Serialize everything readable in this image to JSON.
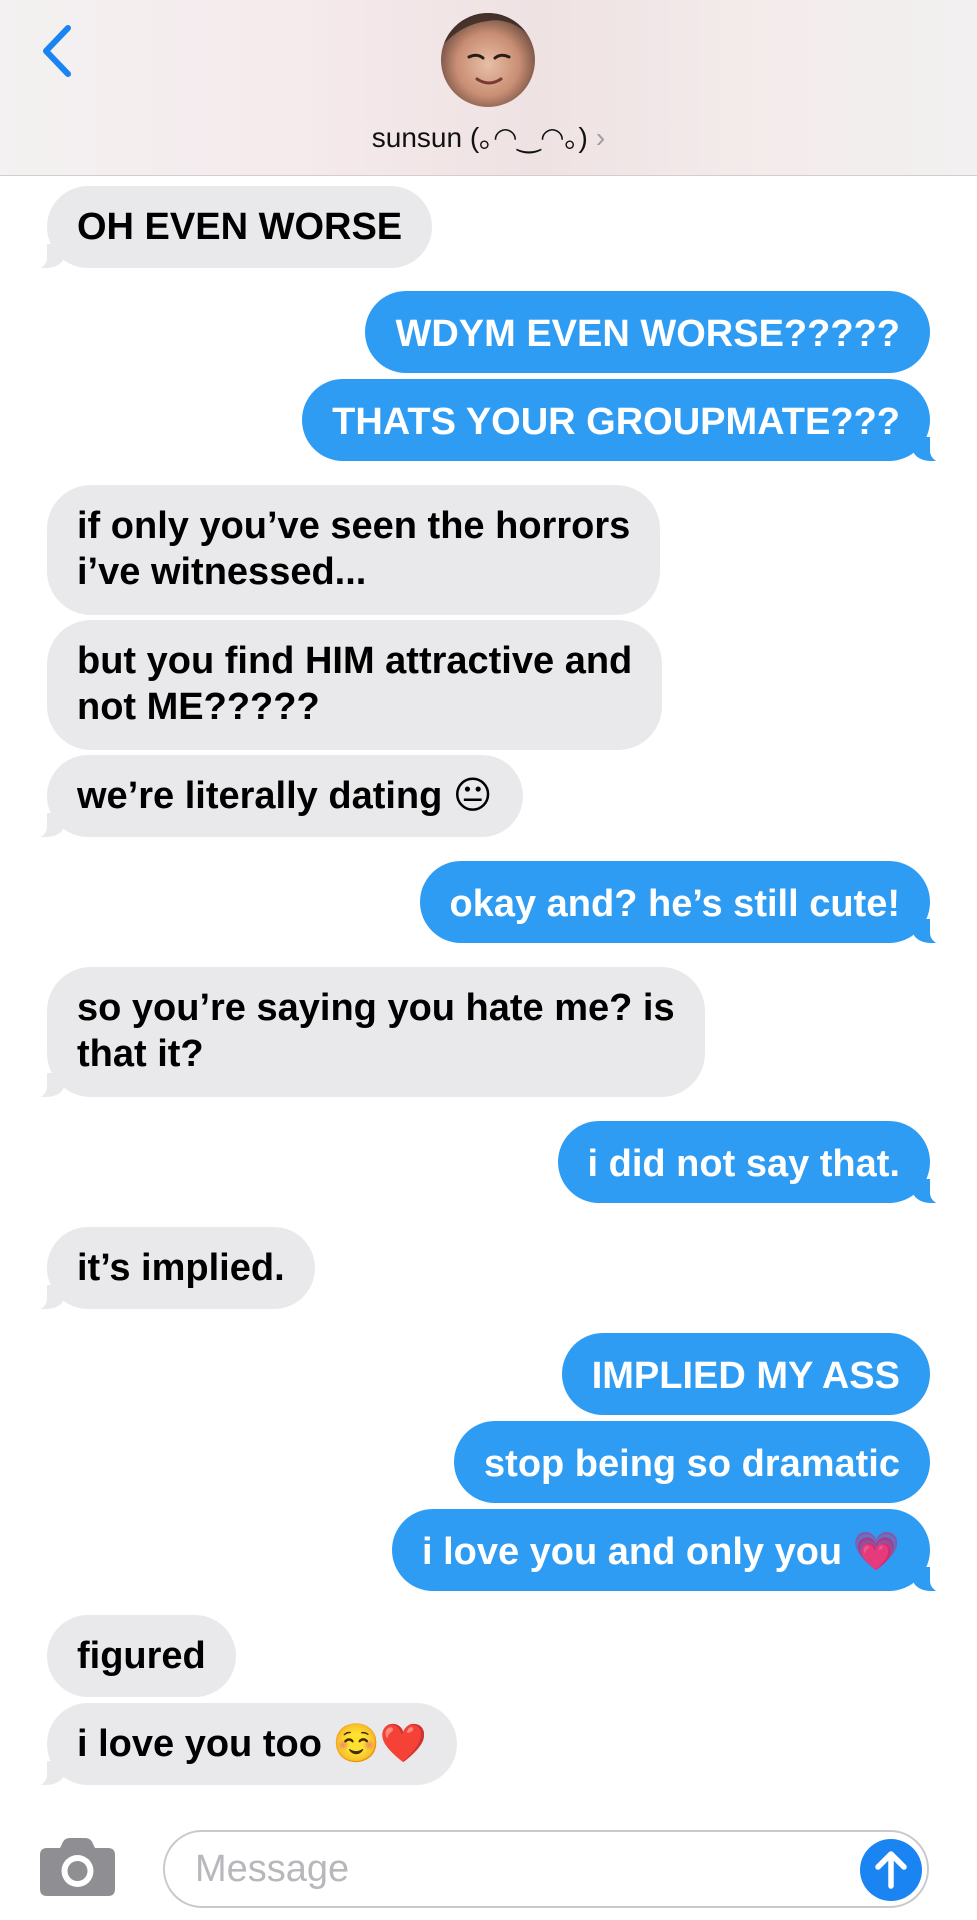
{
  "header": {
    "contact_name": "sunsun (｡◠‿◠｡)",
    "back_icon": "chevron-left-icon",
    "avatar_icon": "contact-avatar"
  },
  "colors": {
    "incoming_bubble": "#e9e9eb",
    "outgoing_bubble": "#2f9cf4",
    "accent": "#1a84f2"
  },
  "messages": [
    {
      "from": "them",
      "text": "OH EVEN WORSE"
    },
    {
      "from": "me",
      "text": "WDYM EVEN WORSE?????"
    },
    {
      "from": "me",
      "text": "THATS YOUR GROUPMATE???"
    },
    {
      "from": "them",
      "text": "if only you’ve seen the horrors\ni’ve witnessed..."
    },
    {
      "from": "them",
      "text": "but you find HIM attractive and\nnot ME?????"
    },
    {
      "from": "them",
      "text": "we’re literally dating 😐"
    },
    {
      "from": "me",
      "text": "okay and? he’s still cute!"
    },
    {
      "from": "them",
      "text": "so you’re saying you hate me? is\nthat it?"
    },
    {
      "from": "me",
      "text": "i did not say that."
    },
    {
      "from": "them",
      "text": "it’s implied."
    },
    {
      "from": "me",
      "text": "IMPLIED MY ASS"
    },
    {
      "from": "me",
      "text": "stop being so dramatic"
    },
    {
      "from": "me",
      "text": "i love you and only you 💗"
    },
    {
      "from": "them",
      "text": "figured"
    },
    {
      "from": "them",
      "text": "i love you too ☺️❤️"
    }
  ],
  "composer": {
    "placeholder": "Message",
    "value": "",
    "camera_icon": "camera-icon",
    "send_icon": "arrow-up-icon"
  }
}
